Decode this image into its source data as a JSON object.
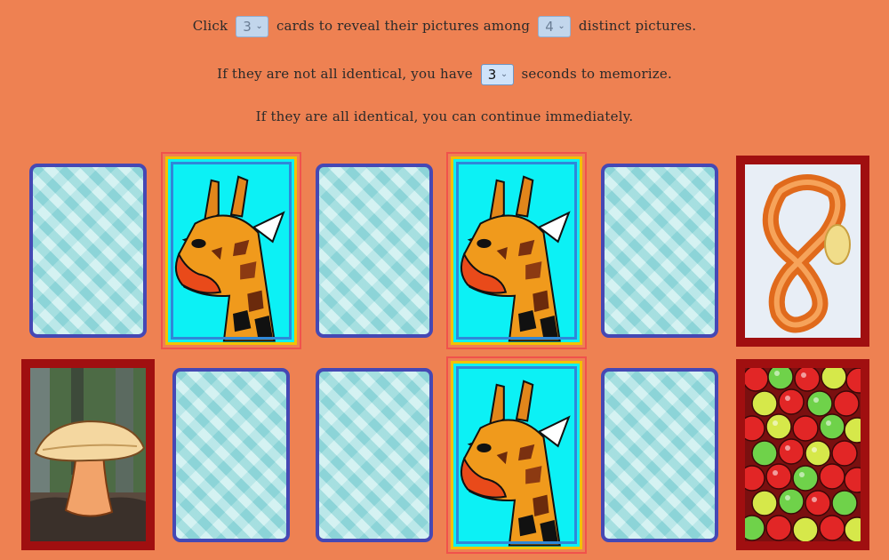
{
  "instructions": {
    "line1_a": "Click",
    "reveal_count": "3",
    "line1_b": "cards to reveal their pictures among",
    "distinct_count": "4",
    "line1_c": "distinct pictures.",
    "line2_a": "If they are not all identical, you have",
    "seconds": "3",
    "line2_b": "seconds to memorize.",
    "line3": "If they are all identical, you can continue immediately."
  },
  "cards": [
    {
      "state": "back"
    },
    {
      "state": "revealed",
      "picture": "giraffe-icon"
    },
    {
      "state": "back"
    },
    {
      "state": "revealed",
      "picture": "giraffe-icon"
    },
    {
      "state": "back"
    },
    {
      "state": "found",
      "picture": "pretzel-icon"
    },
    {
      "state": "found",
      "picture": "mushroom-icon"
    },
    {
      "state": "back"
    },
    {
      "state": "back"
    },
    {
      "state": "revealed",
      "picture": "giraffe-icon"
    },
    {
      "state": "back"
    },
    {
      "state": "found",
      "picture": "apples-icon"
    }
  ],
  "colors": {
    "background": "#ee8152",
    "card_back_border": "#4548b4",
    "card_back_fill": "#a8e4e4",
    "found_frame": "#a00f10",
    "revealed_border": "#f0524c",
    "giraffe_bg": "#0cf1f5"
  }
}
